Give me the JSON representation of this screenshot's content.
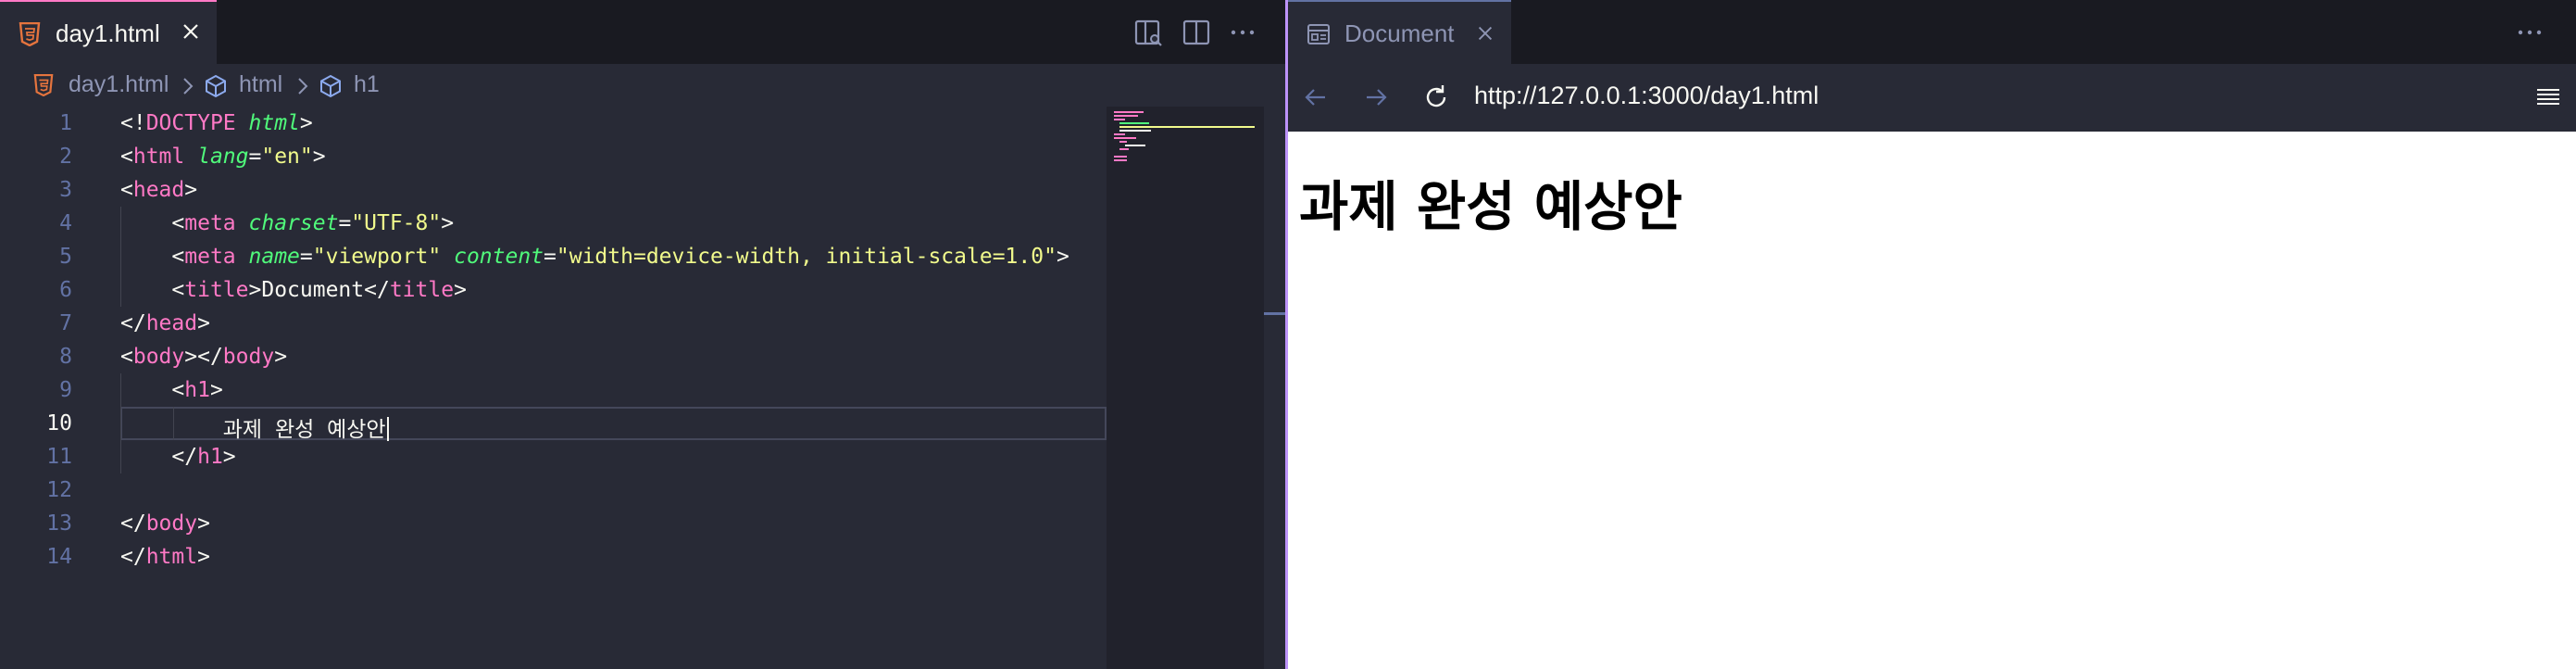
{
  "editor": {
    "tab": {
      "label": "day1.html"
    },
    "breadcrumb": [
      "day1.html",
      "html",
      "h1"
    ],
    "lines": [
      {
        "num": "1",
        "tokens": [
          [
            "<!",
            "p"
          ],
          [
            "DOCTYPE",
            "doc"
          ],
          [
            " ",
            "p"
          ],
          [
            "html",
            "doc2"
          ],
          [
            ">",
            "p"
          ]
        ]
      },
      {
        "num": "2",
        "tokens": [
          [
            "<",
            "p"
          ],
          [
            "html",
            "tag"
          ],
          [
            " ",
            "p"
          ],
          [
            "lang",
            "attr"
          ],
          [
            "=",
            "p"
          ],
          [
            "\"en\"",
            "str"
          ],
          [
            ">",
            "p"
          ]
        ]
      },
      {
        "num": "3",
        "tokens": [
          [
            "<",
            "p"
          ],
          [
            "head",
            "tag"
          ],
          [
            ">",
            "p"
          ]
        ]
      },
      {
        "num": "4",
        "tokens": [
          [
            "    <",
            "p"
          ],
          [
            "meta",
            "tag"
          ],
          [
            " ",
            "p"
          ],
          [
            "charset",
            "attr"
          ],
          [
            "=",
            "p"
          ],
          [
            "\"UTF-8\"",
            "str"
          ],
          [
            ">",
            "p"
          ]
        ]
      },
      {
        "num": "5",
        "tokens": [
          [
            "    <",
            "p"
          ],
          [
            "meta",
            "tag"
          ],
          [
            " ",
            "p"
          ],
          [
            "name",
            "attr"
          ],
          [
            "=",
            "p"
          ],
          [
            "\"viewport\"",
            "str"
          ],
          [
            " ",
            "p"
          ],
          [
            "content",
            "attr"
          ],
          [
            "=",
            "p"
          ],
          [
            "\"width=device-width, initial-scale=1.0\"",
            "str"
          ],
          [
            ">",
            "p"
          ]
        ]
      },
      {
        "num": "6",
        "tokens": [
          [
            "    <",
            "p"
          ],
          [
            "title",
            "tag"
          ],
          [
            ">Document</",
            "p"
          ],
          [
            "title",
            "tag"
          ],
          [
            ">",
            "p"
          ]
        ]
      },
      {
        "num": "7",
        "tokens": [
          [
            "</",
            "p"
          ],
          [
            "head",
            "tag"
          ],
          [
            ">",
            "p"
          ]
        ]
      },
      {
        "num": "8",
        "tokens": [
          [
            "<",
            "p"
          ],
          [
            "body",
            "tag"
          ],
          [
            "></",
            "p"
          ],
          [
            "body",
            "tag"
          ],
          [
            ">",
            "p"
          ]
        ]
      },
      {
        "num": "9",
        "tokens": [
          [
            "    <",
            "p"
          ],
          [
            "h1",
            "tag"
          ],
          [
            ">",
            "p"
          ]
        ]
      },
      {
        "num": "10",
        "tokens": [
          [
            "        과제 완성 예상안",
            "p"
          ]
        ]
      },
      {
        "num": "11",
        "tokens": [
          [
            "    </",
            "p"
          ],
          [
            "h1",
            "tag"
          ],
          [
            ">",
            "p"
          ]
        ]
      },
      {
        "num": "12",
        "tokens": []
      },
      {
        "num": "13",
        "tokens": [
          [
            "</",
            "p"
          ],
          [
            "body",
            "tag"
          ],
          [
            ">",
            "p"
          ]
        ]
      },
      {
        "num": "14",
        "tokens": [
          [
            "</",
            "p"
          ],
          [
            "html",
            "tag"
          ],
          [
            ">",
            "p"
          ]
        ]
      }
    ],
    "current_line": "10"
  },
  "browser": {
    "tab": {
      "label": "Document"
    },
    "url": "http://127.0.0.1:3000/day1.html",
    "page": {
      "heading": "과제 완성 예상안"
    }
  },
  "colors": {
    "accent_pink": "#ff79c6",
    "accent_purple": "#bd93f9",
    "background": "#282a36"
  }
}
